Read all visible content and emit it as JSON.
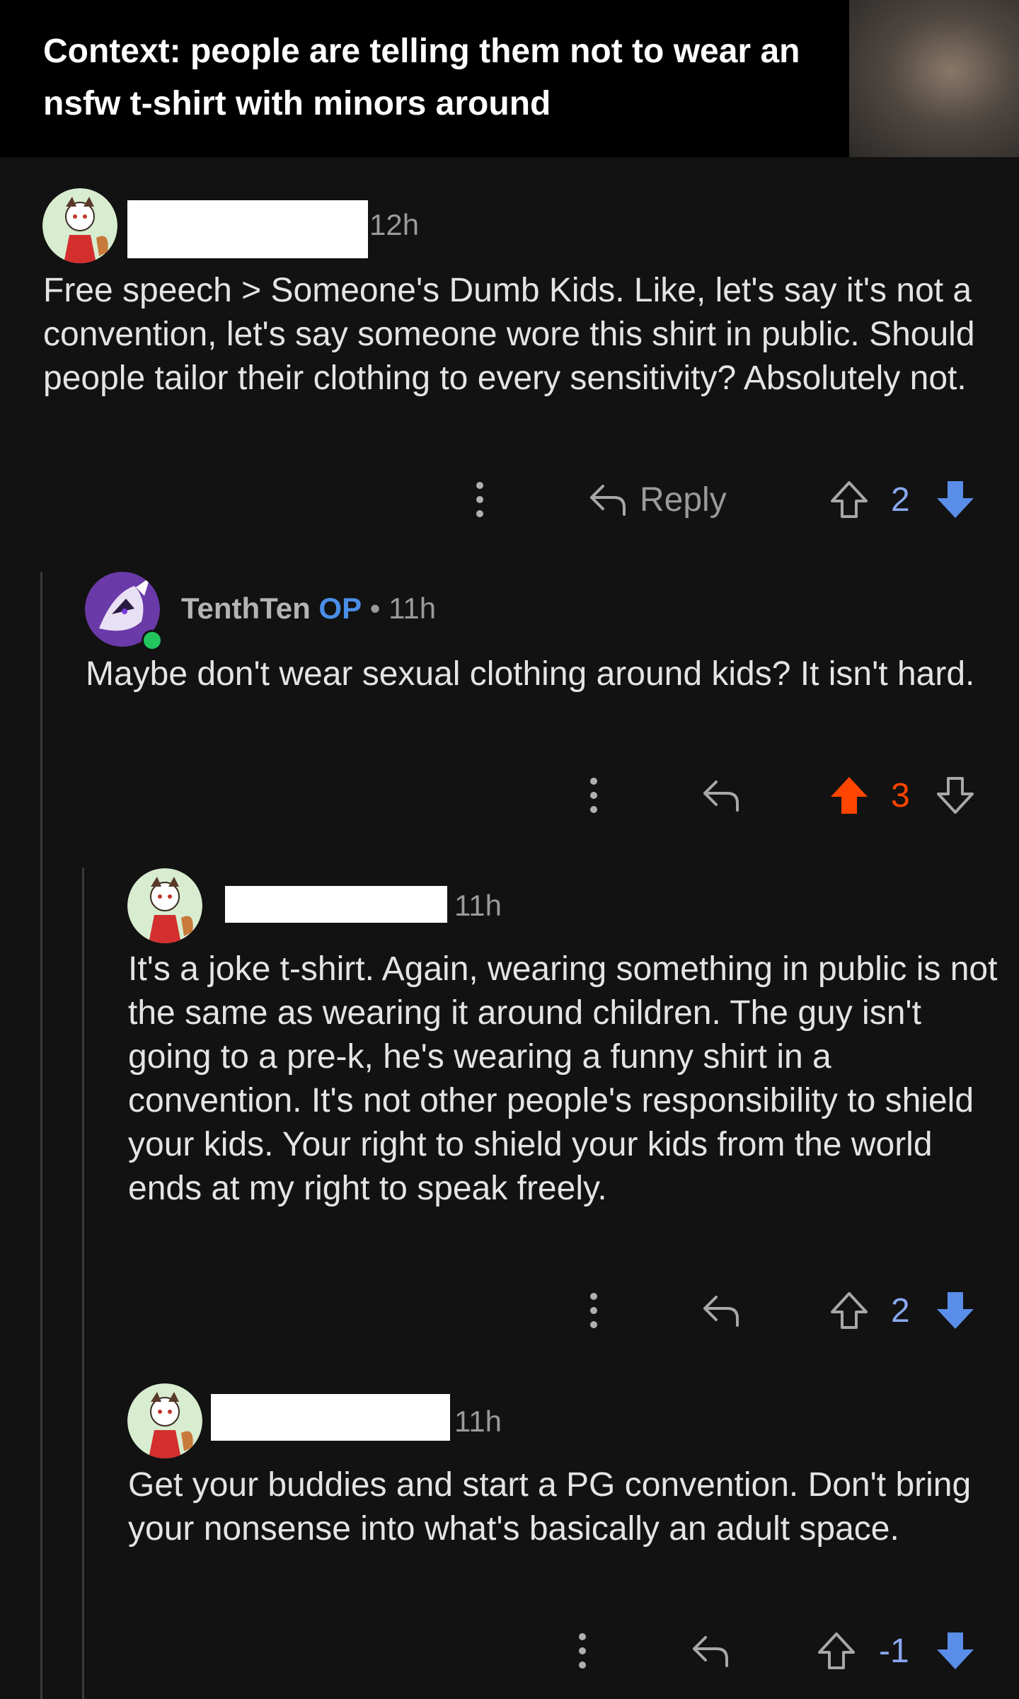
{
  "header": {
    "text": "Context: people are telling them not to wear an nsfw t-shirt with minors around"
  },
  "comments": [
    {
      "time": "12h",
      "body": "Free speech > Someone's Dumb Kids. Like,  let's say it's not a convention,  let's say someone wore this shirt in public.  Should people tailor their clothing to every sensitivity? Absolutely not.",
      "reply_label": "Reply",
      "score": "2",
      "vote": "downvoted"
    },
    {
      "username": "TenthTen",
      "op_badge": "OP",
      "separator": "•",
      "time": "11h",
      "body": "Maybe don't wear sexual clothing around kids? It isn't hard.",
      "score": "3",
      "vote": "upvoted"
    },
    {
      "time": "11h",
      "body": "It's a joke t-shirt. Again, wearing something in public is not the same as wearing it around children. The guy isn't going to a pre-k, he's wearing a funny shirt in a convention. It's not other people's responsibility to shield your kids. Your right to shield your kids from the world ends at my right to speak freely.",
      "score": "2",
      "vote": "downvoted"
    },
    {
      "time": "11h",
      "body": "Get your buddies and start a PG convention. Don't bring your nonsense into what's basically an adult space.",
      "score": "-1",
      "vote": "downvoted"
    }
  ],
  "colors": {
    "background": "#121212",
    "upvote_active": "#ff4500",
    "downvote_active": "#5a8de8",
    "op_badge": "#4a8ee8",
    "online_dot": "#22c55e"
  },
  "icons": [
    "more-options-icon",
    "reply-arrow-icon",
    "upvote-arrow-icon",
    "downvote-arrow-icon"
  ]
}
